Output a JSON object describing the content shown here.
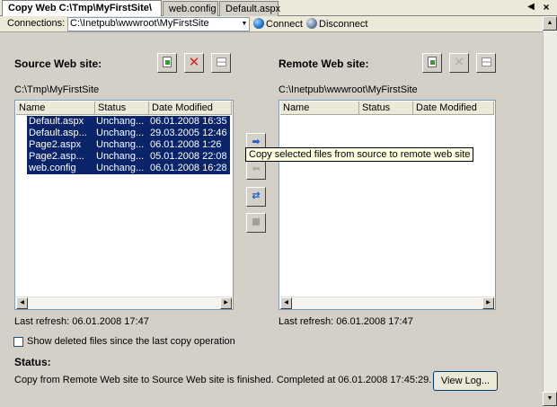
{
  "tabs": [
    {
      "label": "Copy Web C:\\Tmp\\MyFirstSite\\"
    },
    {
      "label": "web.config"
    },
    {
      "label": "Default.aspx"
    }
  ],
  "tab_controls": {
    "scroll_left_icon": "triangle-left",
    "close_icon": "x"
  },
  "connections": {
    "label": "Connections:",
    "selected": "C:\\Inetpub\\wwwroot\\MyFirstSite",
    "connect_label": "Connect",
    "disconnect_label": "Disconnect"
  },
  "source": {
    "heading": "Source Web site:",
    "path": "C:\\Tmp\\MyFirstSite",
    "columns": [
      "Name",
      "Status",
      "Date Modified"
    ],
    "rows": [
      {
        "icon": "aspx-file-icon",
        "name": "Default.aspx",
        "status": "Unchang...",
        "date": "06.01.2008 16:35"
      },
      {
        "icon": "cs-file-icon",
        "name": "Default.asp...",
        "status": "Unchang...",
        "date": "29.03.2005 12:46"
      },
      {
        "icon": "aspx-file-icon",
        "name": "Page2.aspx",
        "status": "Unchang...",
        "date": "06.01.2008 1:26"
      },
      {
        "icon": "cs-file-icon",
        "name": "Page2.asp...",
        "status": "Unchang...",
        "date": "05.01.2008 22:08"
      },
      {
        "icon": "config-file-icon",
        "name": "web.config",
        "status": "Unchang...",
        "date": "06.01.2008 16:28"
      }
    ],
    "last_refresh": "Last refresh: 06.01.2008 17:47"
  },
  "remote": {
    "heading": "Remote Web site:",
    "path": "C:\\Inetpub\\wwwroot\\MyFirstSite",
    "columns": [
      "Name",
      "Status",
      "Date Modified"
    ],
    "rows": [],
    "last_refresh": "Last refresh: 06.01.2008 17:47"
  },
  "tooltip": "Copy selected files from source to remote web site",
  "show_deleted_label": "Show deleted files since the last copy operation",
  "status": {
    "heading": "Status:",
    "message": "Copy from Remote Web site to Source Web site is finished. Completed at 06.01.2008 17:45:29."
  },
  "view_log_label": "View Log...",
  "colors": {
    "selection": "#0a246a",
    "panel": "#d4d0c8",
    "tooltip_bg": "#ffffe1"
  }
}
